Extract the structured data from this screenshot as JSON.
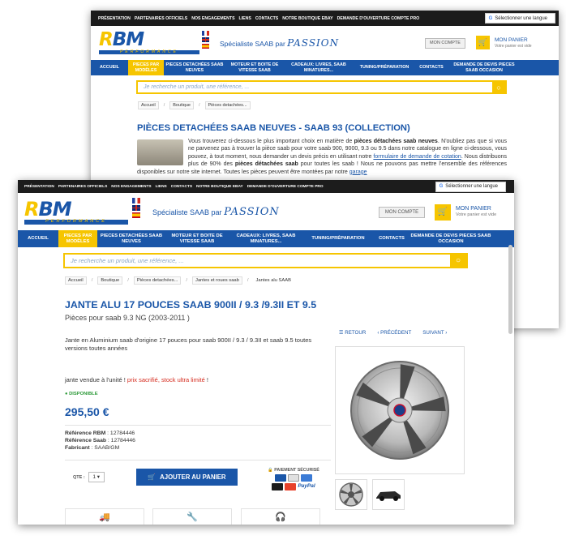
{
  "topbar": {
    "links": [
      "PRÉSENTATION",
      "PARTENAIRES OFFICIELS",
      "NOS ENGAGEMENTS",
      "LIENS",
      "CONTACTS",
      "NOTRE BOUTIQUE EBAY",
      "DEMANDE D'OUVERTURE COMPTE PRO"
    ],
    "translate_label": "Sélectionner une langue"
  },
  "header": {
    "logo_text": "RBM",
    "logo_sub": "PERFORMANCE",
    "tagline": "Spécialiste SAAB par",
    "tagline_brand": "PASSION",
    "account_label": "MON COMPTE",
    "cart_title": "MON PANIER",
    "cart_status": "Votre panier est vide"
  },
  "nav": {
    "items": [
      "ACCUEIL",
      "PIECES PAR MODÈLES",
      "PIECES DETACHÉES SAAB NEUVES",
      "MOTEUR ET BOITE DE VITESSE SAAB",
      "CADEAUX: LIVRES, SAAB MINATURES...",
      "TUNING/PRÉPARATION",
      "CONTACTS",
      "DEMANDE DE DEVIS PIECES SAAB OCCASION"
    ]
  },
  "search": {
    "placeholder": "Je recherche un produit, une référence, ..."
  },
  "back_page": {
    "breadcrumb": [
      "Accueil",
      "Boutique",
      "Pièces detachées..."
    ],
    "title": "PIÈCES DETACHÉES SAAB NEUVES - SAAB 93 (COLLECTION)",
    "intro_1": "Vous trouverez ci-dessous le plus important choix en matière de ",
    "intro_b1": "pièces détachées saab neuves",
    "intro_2": ". N'oubliez pas que si vous ne parvenez pas à trouver la pièce saab pour votre saab 900, 9000, 9.3 ou 9.5 dans notre catalogue en ligne ci-dessous, vous pouvez, à tout moment, nous demander un devis précis en utilisant notre ",
    "intro_link": "formulaire de demande de cotation",
    "intro_3": ". Nous distribuons plus de 90% des ",
    "intro_b2": "pièces détachées saab",
    "intro_4": " pour toutes les saab ! Nous ne pouvons pas mettre l'ensemble des références disponibles sur notre site internet. Toutes les pièces peuvent être montées par notre ",
    "intro_link2": "garage"
  },
  "product": {
    "breadcrumb": [
      "Accueil",
      "Boutique",
      "Pièces detachées...",
      "Jantes et roues saab",
      "Jantes alu SAAB"
    ],
    "title": "JANTE ALU 17 POUCES SAAB 900II / 9.3 /9.3II ET 9.5",
    "subtitle": "Pièces pour saab 9.3 NG (2003-2011 )",
    "description": "Jante en Aluminium saab d'origine 17 pouces pour saab 900II / 9.3 / 9.3II et saab 9.5 toutes versions toutes années",
    "sale_note": "jante vendue à l'unité ! ",
    "sale_note_red": "prix sacrifié,  stock ultra limité",
    "sale_note_end": " !",
    "availability": "DISPONIBLE",
    "price": "295,50 €",
    "ref_rbm_label": "Référence RBM",
    "ref_rbm": " : 12784446",
    "ref_saab_label": "Référence Saab",
    "ref_saab": " : 12784446",
    "maker_label": "Fabricant",
    "maker": " : SAAB/GM",
    "qty_label": "QTE :",
    "qty_value": "1",
    "add_to_cart": "AJOUTER AU PANIER",
    "secure_label": "PAIEMENT SÉCURISÉ",
    "paypal": "PayPal",
    "nav_back": "RETOUR",
    "nav_prev": "PRÉCÉDENT",
    "nav_next": "SUIVANT"
  },
  "colors": {
    "brand_blue": "#1a56a8",
    "brand_yellow": "#f6c500",
    "top_bar": "#1c1c1c",
    "sale_red": "#d52b1e",
    "in_stock": "#2e9a3a"
  }
}
